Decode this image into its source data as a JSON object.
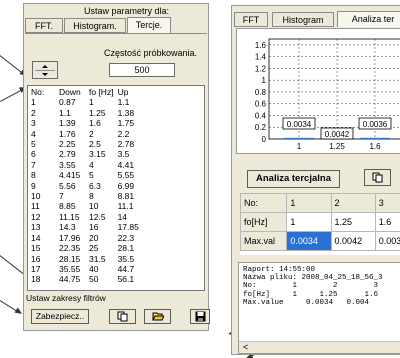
{
  "left_panel": {
    "header": "Ustaw parametry dla:",
    "tabs": [
      "FFT.",
      "Histogram.",
      "Tercje."
    ],
    "sample_rate_label": "Częstość próbkowania.",
    "sample_rate_value": "500",
    "table": {
      "columns": [
        "No:",
        "Down",
        "fo [Hz]",
        "Up"
      ],
      "rows": [
        [
          "1",
          "0.87",
          "1",
          "1.1"
        ],
        [
          "2",
          "1.1",
          "1.25",
          "1.38"
        ],
        [
          "3",
          "1.39",
          "1.6",
          "1.75"
        ],
        [
          "4",
          "1.76",
          "2",
          "2.2"
        ],
        [
          "5",
          "2.25",
          "2.5",
          "2.78"
        ],
        [
          "6",
          "2.79",
          "3.15",
          "3.5"
        ],
        [
          "7",
          "3.55",
          "4",
          "4.41"
        ],
        [
          "8",
          "4.415",
          "5",
          "5.55"
        ],
        [
          "9",
          "5.56",
          "6.3",
          "6.99"
        ],
        [
          "10",
          "7",
          "8",
          "8.81"
        ],
        [
          "11",
          "8.85",
          "10",
          "11.1"
        ],
        [
          "12",
          "11.15",
          "12.5",
          "14"
        ],
        [
          "13",
          "14.3",
          "16",
          "17.85"
        ],
        [
          "14",
          "17.96",
          "20",
          "22.3"
        ],
        [
          "15",
          "22.35",
          "25",
          "28.1"
        ],
        [
          "16",
          "28.15",
          "31.5",
          "35.5"
        ],
        [
          "17",
          "35.55",
          "40",
          "44.7"
        ],
        [
          "18",
          "44.75",
          "50",
          "56.1"
        ]
      ]
    },
    "range_label": "Ustaw zakresy filtrów",
    "protect_button": "Zabezpiecz.."
  },
  "right_panel": {
    "tabs": [
      "FFT",
      "Histogram",
      "Analiza ter"
    ],
    "chart_data": {
      "type": "bar",
      "title": "",
      "xlabel": "",
      "ylabel": "",
      "y_ticks": [
        "1.6",
        "1.4",
        "1.2",
        "1",
        "0.8",
        "0.6",
        "0.4",
        "0.2",
        "0"
      ],
      "x_ticks": [
        "1",
        "1.25",
        "1.6"
      ],
      "ylim": [
        0,
        1.7
      ],
      "categories": [
        "1",
        "1.25",
        "1.6"
      ],
      "values": [
        0.0034,
        0.0042,
        0.0036
      ],
      "data_labels": [
        "0.0034",
        "0.0042",
        "0.0036"
      ]
    },
    "analysis_button": "Analiza tercjalna",
    "grid": {
      "header": [
        "No:",
        "1",
        "2",
        "3"
      ],
      "freq_row": [
        "fo[Hz]",
        "1",
        "1.25",
        "1.6"
      ],
      "max_row": [
        "Max.val",
        "0.0034",
        "0.0042",
        "0.0036"
      ]
    },
    "report_lines": [
      "Raport: 14:55:00",
      "Nazwa pliku: 2008_04_25_18_56_3",
      "No:        1        2        3",
      "fo[Hz]     1     1.25      1.6",
      "Max.value     0.0034   0.004"
    ],
    "scroll_left": "<"
  },
  "icons": {
    "copy": "copy-icon",
    "open": "folder-open-icon",
    "save": "floppy-save-icon"
  }
}
